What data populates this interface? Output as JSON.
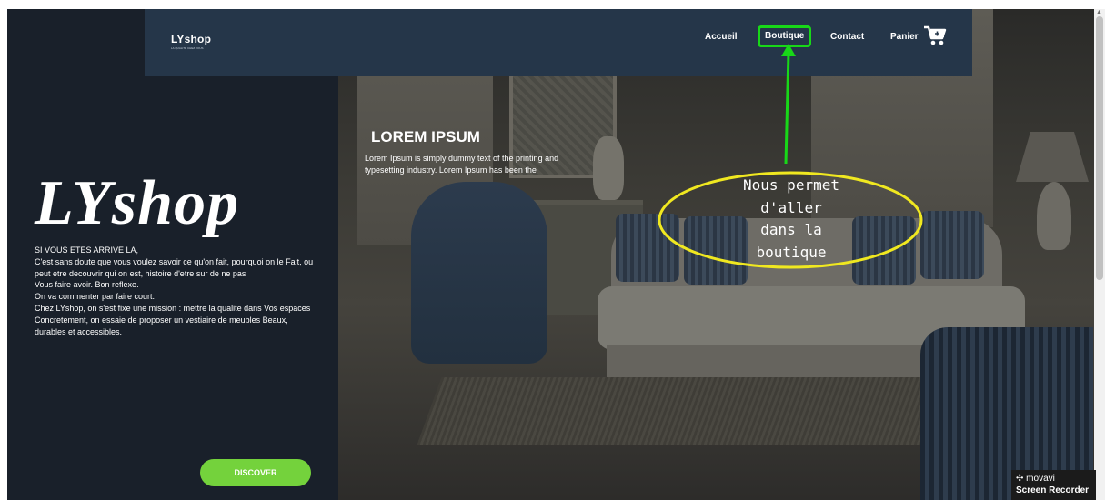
{
  "navbar": {
    "logo": "LYshop",
    "logo_tagline": "LA QUALITE CHEZ VOUS",
    "items": [
      {
        "label": "Accueil"
      },
      {
        "label": "Boutique"
      },
      {
        "label": "Contact"
      },
      {
        "label": "Panier"
      }
    ],
    "cart_icon": "cart-icon",
    "highlight_color": "#18d818",
    "background": "#253649"
  },
  "left_panel": {
    "brand": "LYshop",
    "intro_lines": [
      "SI VOUS ETES ARRIVE LA,",
      "C'est sans doute que vous voulez savoir ce qu'on fait, pourquoi on le Fait, ou peut etre decouvrir qui on est, histoire d'etre sur de ne pas",
      "Vous faire avoir. Bon reflexe.",
      "On va commenter par faire court.",
      "Chez LYshop, on s'est fixe une mission : mettre la qualite dans Vos espaces",
      "Concretement, on essaie de proposer un vestiaire de meubles Beaux, durables et accessibles."
    ],
    "discover_label": "DISCOVER",
    "discover_color": "#74d23c",
    "background": "#19202a"
  },
  "hero": {
    "title": "LOREM IPSUM",
    "body": "Lorem Ipsum is simply dummy text of the printing and typesetting industry. Lorem Ipsum has been the"
  },
  "annotation": {
    "text_lines": [
      "Nous permet",
      "d'aller",
      "dans la",
      "boutique"
    ],
    "ellipse_color": "#f0e820",
    "arrow_color": "#18d818"
  },
  "watermark": {
    "brand": "movavi",
    "product": "Screen Recorder"
  }
}
